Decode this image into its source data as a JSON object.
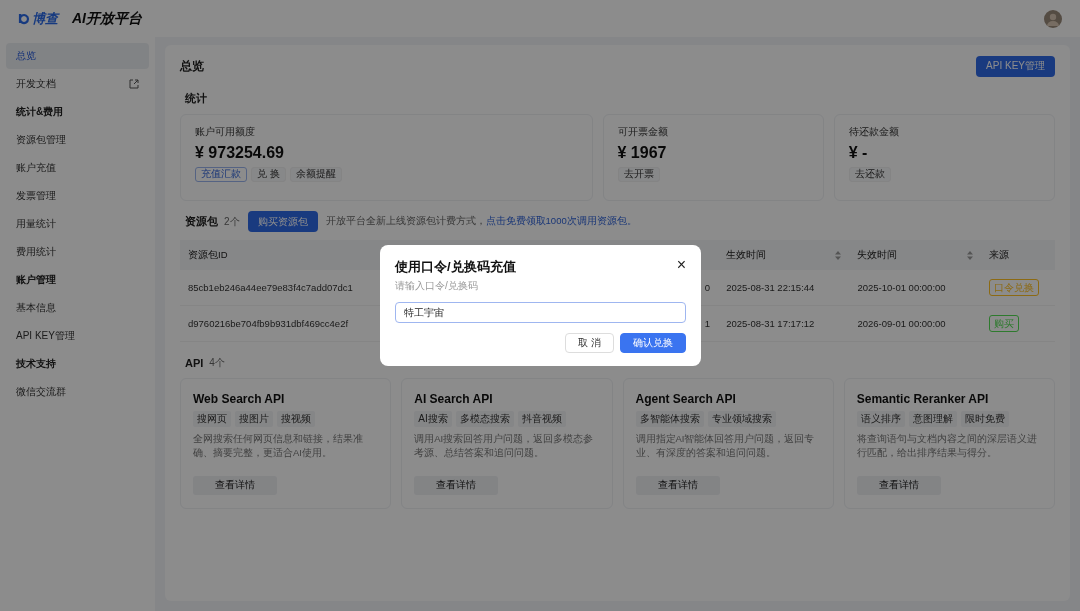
{
  "header": {
    "logo_text": "博查",
    "title": "AI开放平台"
  },
  "sidebar": {
    "items": [
      {
        "kind": "item",
        "label": "总览",
        "selected": true
      },
      {
        "kind": "link",
        "label": "开发文档",
        "selected": false
      },
      {
        "kind": "group",
        "label": "统计&费用"
      },
      {
        "kind": "item",
        "label": "资源包管理",
        "selected": false
      },
      {
        "kind": "item",
        "label": "账户充值",
        "selected": false
      },
      {
        "kind": "item",
        "label": "发票管理",
        "selected": false
      },
      {
        "kind": "item",
        "label": "用量统计",
        "selected": false
      },
      {
        "kind": "item",
        "label": "费用统计",
        "selected": false
      },
      {
        "kind": "group",
        "label": "账户管理"
      },
      {
        "kind": "item",
        "label": "基本信息",
        "selected": false
      },
      {
        "kind": "item",
        "label": "API KEY管理",
        "selected": false
      },
      {
        "kind": "group",
        "label": "技术支持"
      },
      {
        "kind": "item",
        "label": "微信交流群",
        "selected": false
      }
    ]
  },
  "page": {
    "title": "总览",
    "api_key_button": "API KEY管理"
  },
  "stats": {
    "title": "统计",
    "cards": [
      {
        "label": "账户可用额度",
        "value": "¥ 973254.69",
        "actions": [
          {
            "label": "充值汇款",
            "primary": true
          },
          {
            "label": "兑 换",
            "primary": false
          },
          {
            "label": "余额提醒",
            "primary": false
          }
        ]
      },
      {
        "label": "可开票金额",
        "value": "¥ 1967",
        "actions": [
          {
            "label": "去开票",
            "primary": false
          }
        ]
      },
      {
        "label": "待还款金额",
        "value": "¥ -",
        "actions": [
          {
            "label": "去还款",
            "primary": false
          }
        ]
      }
    ]
  },
  "packages": {
    "title": "资源包",
    "count": "2个",
    "buy_button": "购买资源包",
    "notice": "开放平台全新上线资源包计费方式，",
    "notice_link": "点击免费领取1000次调用资源包。",
    "table": {
      "columns": [
        "资源包ID",
        "生效时间",
        "失效时间",
        "来源"
      ],
      "rows": [
        {
          "id": "85cb1eb246a44ee79e83f4c7add07dc1",
          "column_2": "0",
          "start": "2025-08-31 22:15:44",
          "end": "2025-10-01 00:00:00",
          "source": "口令兑换",
          "color": "#8c6a14"
        },
        {
          "id": "d9760216be704fb9b931dbf469cc4e2f",
          "column_2": "1",
          "start": "2025-08-31 17:17:12",
          "end": "2026-09-01 00:00:00",
          "source": "购买",
          "color": "#2e7a2e"
        }
      ]
    }
  },
  "apis": {
    "title": "API",
    "count": "4个",
    "cards": [
      {
        "name": "Web Search API",
        "tags": [
          "搜网页",
          "搜图片",
          "搜视频"
        ],
        "description": "全网搜索任何网页信息和链接，结果准确、摘要完整，更适合AI使用。",
        "button": "查看详情"
      },
      {
        "name": "AI Search API",
        "tags": [
          "AI搜索",
          "多模态搜索",
          "抖音视频"
        ],
        "description": "调用AI搜索回答用户问题，返回多模态参考源、总结答案和追问问题。",
        "button": "查看详情"
      },
      {
        "name": "Agent Search API",
        "tags": [
          "多智能体搜索",
          "专业领域搜索"
        ],
        "description": "调用指定AI智能体回答用户问题，返回专业、有深度的答案和追问问题。",
        "button": "查看详情"
      },
      {
        "name": "Semantic Reranker API",
        "tags": [
          "语义排序",
          "意图理解",
          "限时免费"
        ],
        "description": "将查询语句与文档内容之间的深层语义进行匹配，给出排序结果与得分。",
        "button": "查看详情"
      }
    ]
  },
  "dialog": {
    "title": "使用口令/兑换码充值",
    "subtitle": "请输入口令/兑换码",
    "value": "特工宇宙",
    "close": "×",
    "cancel": "取 消",
    "confirm": "确认兑换"
  }
}
